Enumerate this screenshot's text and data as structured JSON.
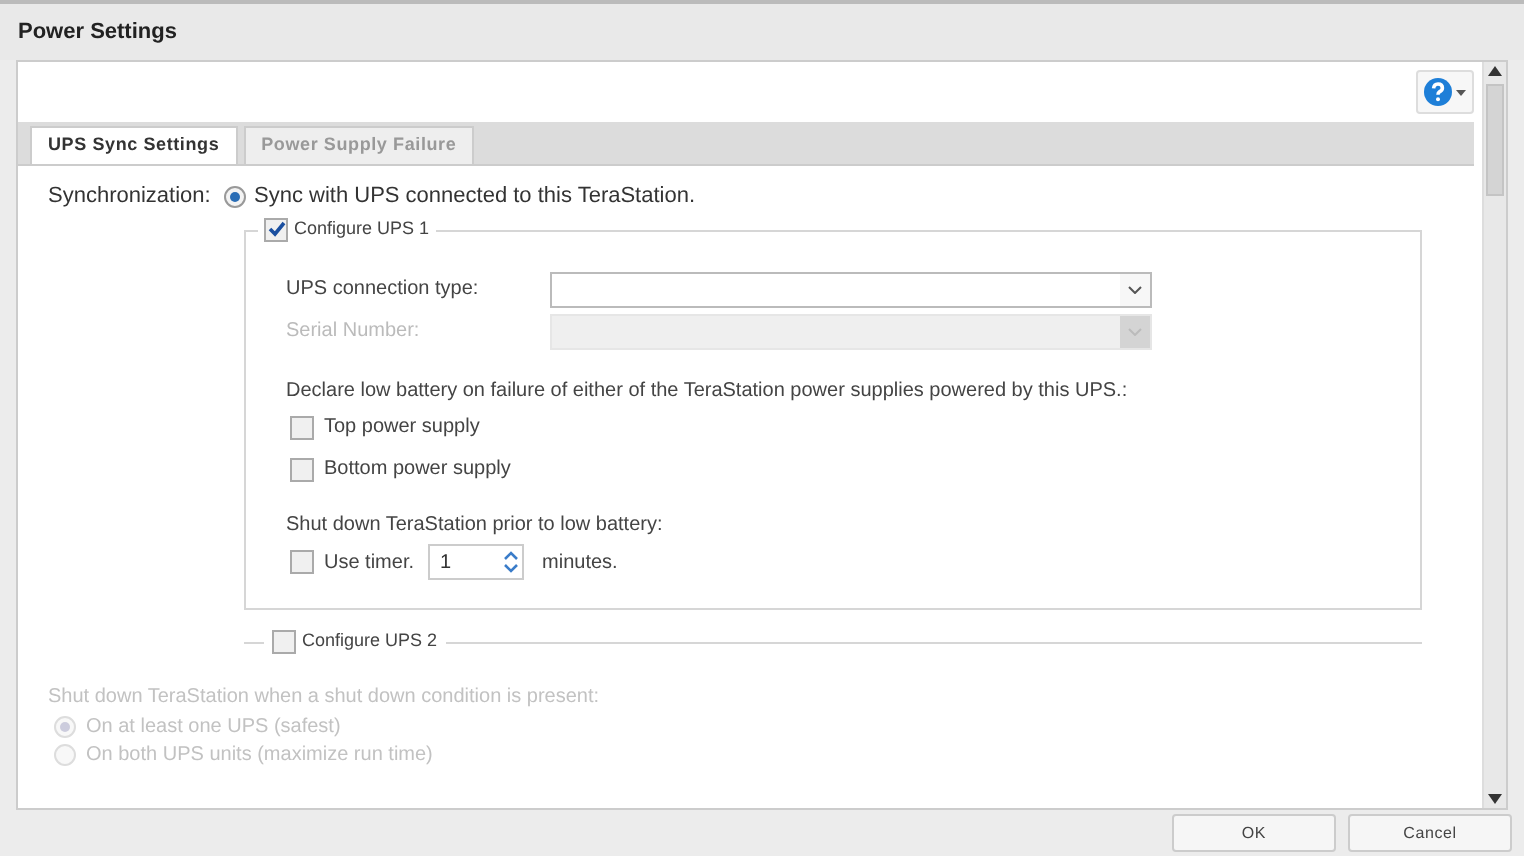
{
  "window": {
    "title": "Power Settings"
  },
  "tabs": [
    {
      "label": "UPS Sync Settings",
      "selected": true
    },
    {
      "label": "Power Supply Failure",
      "selected": false
    }
  ],
  "synchronization": {
    "label": "Synchronization:",
    "option": {
      "label": "Sync with UPS connected to this TeraStation.",
      "selected": true
    }
  },
  "ups_1": {
    "label": "Configure UPS 1",
    "checked": true,
    "fields": [
      {
        "label": "UPS connection type:",
        "disabled": false
      },
      {
        "label": "Serial Number:",
        "disabled": true
      }
    ],
    "declare_text": "Declare low battery on failure of either of the TeraStation power supplies powered by this UPS.:",
    "supplies": [
      {
        "label": "Top power supply",
        "checked": false
      },
      {
        "label": "Bottom power supply",
        "checked": false
      }
    ],
    "shutdown_text": "Shut down TeraStation prior to low battery:",
    "timer": {
      "label": "Use timer.",
      "checked": false,
      "value": "1",
      "unit": "minutes."
    }
  },
  "ups_2": {
    "label": "Configure UPS 2",
    "checked": false
  },
  "shutdown_condition": {
    "label": "Shut down TeraStation when a shut down condition is present:",
    "disabled": true,
    "options": [
      {
        "label": "On at least one UPS (safest)",
        "selected": true
      },
      {
        "label": "On both UPS units (maximize run time)",
        "selected": false
      }
    ]
  },
  "buttons": [
    {
      "label": "OK"
    },
    {
      "label": "Cancel"
    }
  ]
}
